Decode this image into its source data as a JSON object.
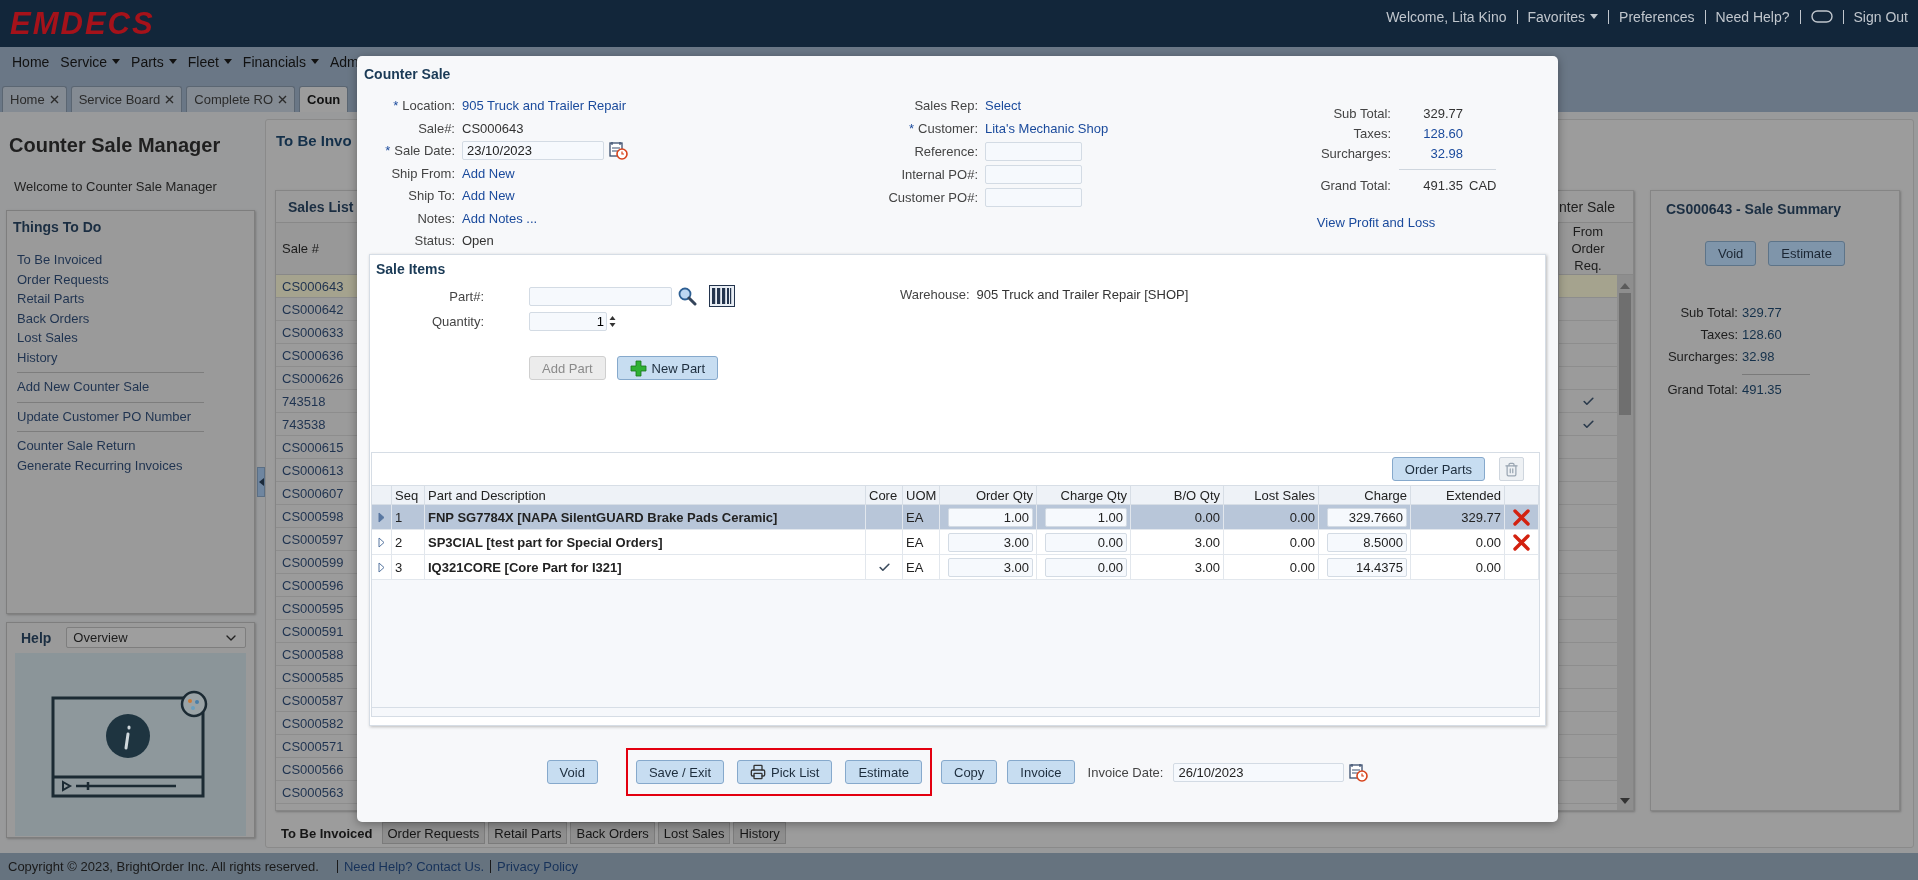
{
  "header": {
    "logo": "EMDECS",
    "items": [
      {
        "kind": "text",
        "label": "Welcome, Lita Kino"
      },
      {
        "kind": "menu",
        "label": "Favorites"
      },
      {
        "kind": "link",
        "label": "Preferences"
      },
      {
        "kind": "link",
        "label": "Need Help?"
      },
      {
        "kind": "toggle"
      },
      {
        "kind": "link",
        "label": "Sign Out"
      }
    ]
  },
  "menu": [
    {
      "label": "Home",
      "dropdown": false
    },
    {
      "label": "Service",
      "dropdown": true
    },
    {
      "label": "Parts",
      "dropdown": true
    },
    {
      "label": "Fleet",
      "dropdown": true
    },
    {
      "label": "Financials",
      "dropdown": true
    },
    {
      "label": "Adm",
      "dropdown": false
    }
  ],
  "tabs": [
    {
      "label": "Home",
      "closable": true,
      "selected": false
    },
    {
      "label": "Service Board",
      "closable": true,
      "selected": false
    },
    {
      "label": "Complete RO",
      "closable": true,
      "selected": false
    },
    {
      "label": "Coun",
      "closable": false,
      "selected": true
    }
  ],
  "sidebar": {
    "title": "Counter Sale Manager",
    "welcome": "Welcome to Counter Sale Manager",
    "things_to_do": {
      "title": "Things To Do",
      "groups": [
        [
          "To Be Invoiced",
          "Order Requests",
          "Retail Parts",
          "Back Orders",
          "Lost Sales",
          "History"
        ],
        [
          "Add New Counter Sale"
        ],
        [
          "Update Customer PO Number"
        ],
        [
          "Counter Sale Return",
          "Generate Recurring Invoices"
        ]
      ]
    },
    "help": {
      "title": "Help",
      "topic": "Overview"
    }
  },
  "content": {
    "title": "To Be Invo",
    "sales_list": {
      "title": "Sales List",
      "header_right": "nter Sale",
      "columns": [
        "Sale #",
        "From Order Req."
      ],
      "rows": [
        {
          "sale": "CS000643",
          "selected": true,
          "from_order_req": false
        },
        {
          "sale": "CS000642",
          "selected": false,
          "from_order_req": false
        },
        {
          "sale": "CS000633",
          "selected": false,
          "from_order_req": false
        },
        {
          "sale": "CS000636",
          "selected": false,
          "from_order_req": false
        },
        {
          "sale": "CS000626",
          "selected": false,
          "from_order_req": false
        },
        {
          "sale": "743518",
          "selected": false,
          "from_order_req": true
        },
        {
          "sale": "743538",
          "selected": false,
          "from_order_req": true
        },
        {
          "sale": "CS000615",
          "selected": false,
          "from_order_req": false
        },
        {
          "sale": "CS000613",
          "selected": false,
          "from_order_req": false
        },
        {
          "sale": "CS000607",
          "selected": false,
          "from_order_req": false
        },
        {
          "sale": "CS000598",
          "selected": false,
          "from_order_req": false
        },
        {
          "sale": "CS000597",
          "selected": false,
          "from_order_req": false
        },
        {
          "sale": "CS000599",
          "selected": false,
          "from_order_req": false
        },
        {
          "sale": "CS000596",
          "selected": false,
          "from_order_req": false
        },
        {
          "sale": "CS000595",
          "selected": false,
          "from_order_req": false
        },
        {
          "sale": "CS000591",
          "selected": false,
          "from_order_req": false
        },
        {
          "sale": "CS000588",
          "selected": false,
          "from_order_req": false
        },
        {
          "sale": "CS000585",
          "selected": false,
          "from_order_req": false
        },
        {
          "sale": "CS000587",
          "selected": false,
          "from_order_req": false
        },
        {
          "sale": "CS000582",
          "selected": false,
          "from_order_req": false
        },
        {
          "sale": "CS000571",
          "selected": false,
          "from_order_req": false
        },
        {
          "sale": "CS000566",
          "selected": false,
          "from_order_req": false
        },
        {
          "sale": "CS000563",
          "selected": false,
          "from_order_req": false
        }
      ]
    },
    "summary": {
      "title": "CS000643 - Sale Summary",
      "buttons": [
        "Void",
        "Estimate"
      ],
      "lines": [
        {
          "label": "Sub Total:",
          "value": "329.77"
        },
        {
          "label": "Taxes:",
          "value": "128.60"
        },
        {
          "label": "Surcharges:",
          "value": "32.98"
        }
      ],
      "grand_total": {
        "label": "Grand Total:",
        "value": "491.35"
      }
    },
    "bottom_tabs": [
      {
        "label": "To Be Invoiced",
        "selected": true
      },
      {
        "label": "Order Requests",
        "selected": false
      },
      {
        "label": "Retail Parts",
        "selected": false
      },
      {
        "label": "Back Orders",
        "selected": false
      },
      {
        "label": "Lost Sales",
        "selected": false
      },
      {
        "label": "History",
        "selected": false
      }
    ]
  },
  "footer": {
    "copyright": "Copyright © 2023, BrightOrder Inc. All rights reserved.",
    "links": [
      "Need Help? Contact Us.",
      "Privacy Policy"
    ]
  },
  "modal": {
    "title": "Counter Sale",
    "left_fields": [
      {
        "label": "Location:",
        "mark": "*",
        "kind": "link",
        "value": "905 Truck and Trailer Repair"
      },
      {
        "label": "Sale#:",
        "kind": "text",
        "value": "CS000643"
      },
      {
        "label": "Sale Date:",
        "mark": "*",
        "kind": "date",
        "value": "23/10/2023"
      },
      {
        "label": "Ship From:",
        "kind": "link",
        "value": "Add New"
      },
      {
        "label": "Ship To:",
        "kind": "link",
        "value": "Add New"
      },
      {
        "label": "Notes:",
        "kind": "link",
        "value": "Add Notes ..."
      },
      {
        "label": "Status:",
        "kind": "text",
        "value": "Open"
      }
    ],
    "middle_fields": [
      {
        "label": "Sales Rep:",
        "kind": "link",
        "value": "Select"
      },
      {
        "label": "Customer:",
        "mark": "*",
        "kind": "link",
        "value": "Lita's Mechanic Shop"
      },
      {
        "label": "Reference:",
        "kind": "input"
      },
      {
        "label": "Internal PO#:",
        "kind": "input"
      },
      {
        "label": "Customer PO#:",
        "kind": "input"
      }
    ],
    "totals": [
      {
        "label": "Sub Total:",
        "value": "329.77",
        "link": false
      },
      {
        "label": "Taxes:",
        "value": "128.60",
        "link": true
      },
      {
        "label": "Surcharges:",
        "value": "32.98",
        "link": true
      }
    ],
    "grand_total": {
      "label": "Grand Total:",
      "value": "491.35",
      "currency": "CAD"
    },
    "profit_link": "View Profit and Loss",
    "sale_items": {
      "title": "Sale Items",
      "part_label": "Part#:",
      "quantity_label": "Quantity:",
      "quantity": "1",
      "warehouse_label": "Warehouse:",
      "warehouse": "905 Truck and Trailer Repair [SHOP]",
      "add_part": {
        "label": "Add Part",
        "disabled": true
      },
      "new_part": "New Part",
      "order_parts": "Order Parts",
      "columns": [
        "Seq",
        "Part and Description",
        "Core",
        "UOM",
        "Order Qty",
        "Charge Qty",
        "B/O Qty",
        "Lost Sales",
        "Charge",
        "Extended"
      ],
      "rows": [
        {
          "seq": "1",
          "part": "FNP SG7784X [NAPA SilentGUARD Brake Pads Ceramic]",
          "core": false,
          "uom": "EA",
          "order_qty": "1.00",
          "charge_qty": "1.00",
          "bo_qty": "0.00",
          "lost_sales": "0.00",
          "charge": "329.7660",
          "extended": "329.77",
          "deletable": true,
          "selected": true
        },
        {
          "seq": "2",
          "part": "SP3CIAL [test part for Special Orders]",
          "core": false,
          "uom": "EA",
          "order_qty": "3.00",
          "charge_qty": "0.00",
          "bo_qty": "3.00",
          "lost_sales": "0.00",
          "charge": "8.5000",
          "extended": "0.00",
          "deletable": true,
          "selected": false
        },
        {
          "seq": "3",
          "part": "IQ321CORE [Core Part for I321]",
          "core": true,
          "uom": "EA",
          "order_qty": "3.00",
          "charge_qty": "0.00",
          "bo_qty": "3.00",
          "lost_sales": "0.00",
          "charge": "14.4375",
          "extended": "0.00",
          "deletable": false,
          "selected": false
        }
      ]
    },
    "actions": [
      {
        "label": "Void",
        "kind": "button",
        "highlighted": false
      },
      {
        "label": "Save / Exit",
        "kind": "button",
        "highlighted": true
      },
      {
        "label": "Pick List",
        "kind": "print",
        "highlighted": true
      },
      {
        "label": "Estimate",
        "kind": "button",
        "highlighted": true
      },
      {
        "label": "Copy",
        "kind": "button",
        "highlighted": false
      },
      {
        "label": "Invoice",
        "kind": "button",
        "highlighted": false
      }
    ],
    "invoice_date": {
      "label": "Invoice Date:",
      "value": "26/10/2023"
    }
  }
}
